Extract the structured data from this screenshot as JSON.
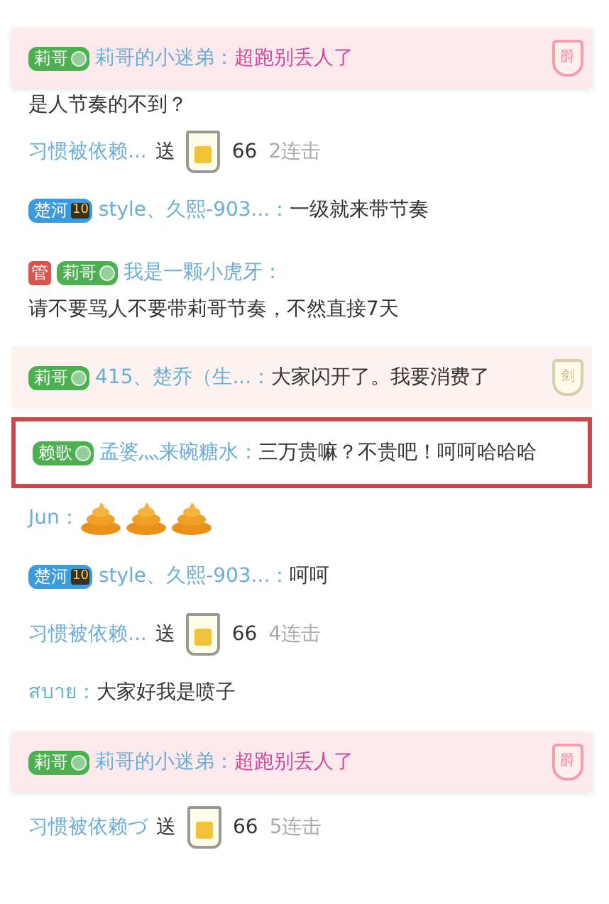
{
  "messages": [
    {
      "kind": "notice",
      "badges": [
        {
          "kind": "fan",
          "label": "莉哥",
          "color": "#4caf50"
        }
      ],
      "user": "莉哥的小迷弟：",
      "text": "超跑别丢人了",
      "emblem": "爵"
    },
    {
      "kind": "partial",
      "text": "是人节奏的不到？"
    },
    {
      "kind": "gift",
      "user": "习惯被依赖...",
      "verb": "送",
      "count": "66",
      "combo": "2连击"
    },
    {
      "kind": "chat",
      "badges": [
        {
          "kind": "fan",
          "label": "楚河",
          "color": "#3b9be0",
          "level": "10"
        }
      ],
      "user": "style、久熙-903...：",
      "text": "一级就来带节奏"
    },
    {
      "kind": "chat",
      "badges": [
        {
          "kind": "admin",
          "label": "管",
          "color": "#d9534f"
        },
        {
          "kind": "fan",
          "label": "莉哥",
          "color": "#4caf50"
        }
      ],
      "user": "我是一颗小虎牙：",
      "text": "请不要骂人不要带莉哥节奏，不然直接7天"
    },
    {
      "kind": "chat",
      "tinted": true,
      "badges": [
        {
          "kind": "fan",
          "label": "莉哥",
          "color": "#4caf50"
        }
      ],
      "user": "415、楚乔（生...：",
      "text": "大家闪开了。我要消费了",
      "emblem": "剑"
    },
    {
      "kind": "chat",
      "outlined": true,
      "badges": [
        {
          "kind": "fan",
          "label": "赖歌",
          "color": "#4caf50"
        }
      ],
      "user": "孟婆灬来碗糖水：",
      "text": "三万贵嘛？不贵吧！呵呵哈哈哈"
    },
    {
      "kind": "emoji",
      "user": "Jun：",
      "emojis": [
        {
          "kind": "poop"
        },
        {
          "kind": "poop"
        },
        {
          "kind": "poop"
        }
      ]
    },
    {
      "kind": "chat",
      "badges": [
        {
          "kind": "fan",
          "label": "楚河",
          "color": "#3b9be0",
          "level": "10"
        }
      ],
      "user": "style、久熙-903...：",
      "text": "呵呵"
    },
    {
      "kind": "gift",
      "user": "习惯被依赖...",
      "verb": "送",
      "count": "66",
      "combo": "4连击"
    },
    {
      "kind": "chat",
      "user": "สบาย：",
      "text": "大家好我是喷子"
    },
    {
      "kind": "notice",
      "badges": [
        {
          "kind": "fan",
          "label": "莉哥",
          "color": "#4caf50"
        }
      ],
      "user": "莉哥的小迷弟：",
      "text": "超跑别丢人了",
      "emblem": "爵"
    },
    {
      "kind": "gift",
      "user": "习惯被依赖づ",
      "verb": "送",
      "count": "66",
      "combo": "5连击"
    }
  ]
}
